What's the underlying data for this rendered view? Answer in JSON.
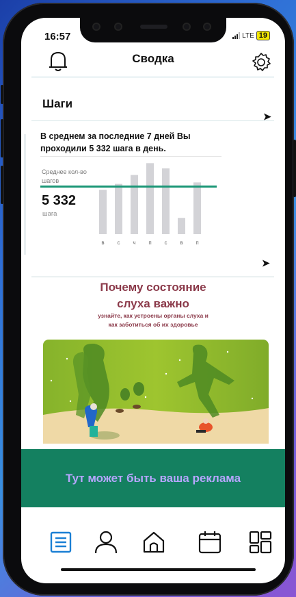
{
  "status": {
    "time": "16:57",
    "network": "LTE",
    "battery": "19"
  },
  "header": {
    "title": "Сводка",
    "bell_icon": "bell-icon",
    "settings_icon": "gear-icon"
  },
  "steps": {
    "section_title": "Шаги",
    "average_text": "В среднем за последние 7 дней Вы проходили 5 332 шага в день.",
    "average_label": "Среднее кол-во шагов",
    "average_value": "5 332",
    "average_unit": "шага"
  },
  "chart_data": {
    "type": "bar",
    "categories": [
      "в",
      "с",
      "ч",
      "п",
      "с",
      "в",
      "п"
    ],
    "values": [
      0.6,
      0.68,
      0.8,
      0.96,
      0.89,
      0.22,
      0.7
    ],
    "average_fraction": 0.74,
    "colors": {
      "bar": "#d3d3d7",
      "average_line": "#1a9676"
    }
  },
  "article": {
    "title_line1": "Почему состояние",
    "title_line2": "слуха важно",
    "subtitle_line1": "узнайте, как устроены органы слуха и",
    "subtitle_line2": "как заботиться об их здоровье"
  },
  "ad": {
    "text": "Тут может быть ваша реклама"
  },
  "tabbar": [
    {
      "icon": "list-icon",
      "active": true
    },
    {
      "icon": "person-icon",
      "active": false
    },
    {
      "icon": "home-icon",
      "active": false
    },
    {
      "icon": "calendar-icon",
      "active": false
    },
    {
      "icon": "dashboard-icon",
      "active": false
    }
  ],
  "colors": {
    "accent": "#1a7fd4",
    "ad_bg": "#148060",
    "article_title": "#8b3a4a"
  }
}
